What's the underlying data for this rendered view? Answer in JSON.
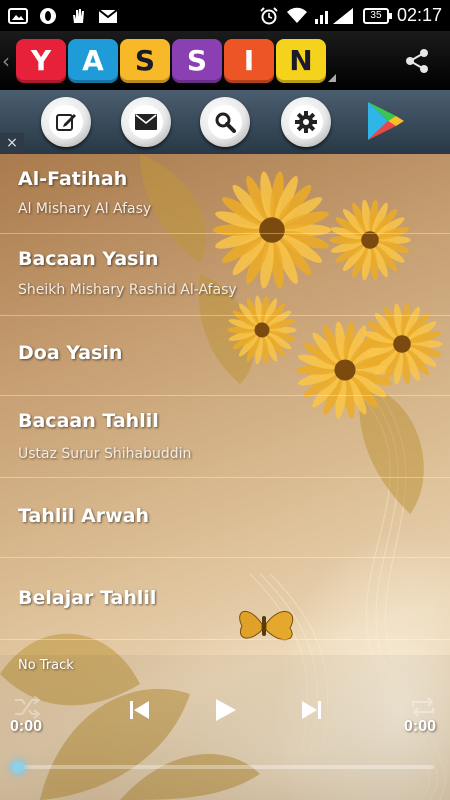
{
  "status_bar": {
    "time": "02:17",
    "battery_level": "35",
    "icons": [
      "gallery-icon",
      "opera-icon",
      "hand-icon",
      "gmail-icon",
      "alarm-icon",
      "wifi-icon",
      "signal-icon",
      "battery-icon"
    ]
  },
  "app": {
    "logo_letters": [
      {
        "letter": "Y",
        "color": "#e8213a"
      },
      {
        "letter": "A",
        "color": "#1f9bd8"
      },
      {
        "letter": "S",
        "color": "#f7b928"
      },
      {
        "letter": "S",
        "color": "#8a3fb3"
      },
      {
        "letter": "I",
        "color": "#ee5525"
      },
      {
        "letter": "N",
        "color": "#f5d31c"
      }
    ]
  },
  "toolbar": {
    "buttons": [
      "edit-icon",
      "mail-icon",
      "search-icon",
      "settings-icon",
      "play-store-icon"
    ],
    "close_label": "×"
  },
  "tracks": [
    {
      "title": "Al-Fatihah",
      "subtitle": "Al Mishary Al Afasy"
    },
    {
      "title": "Bacaan Yasin",
      "subtitle": "Sheikh Mishary Rashid Al-Afasy"
    },
    {
      "title": "Doa Yasin",
      "subtitle": ""
    },
    {
      "title": "Bacaan Tahlil",
      "subtitle": "Ustaz Surur Shihabuddin"
    },
    {
      "title": "Tahlil Arwah",
      "subtitle": ""
    },
    {
      "title": "Belajar Tahlil",
      "subtitle": ""
    }
  ],
  "player": {
    "now_playing": "No Track",
    "elapsed": "0:00",
    "duration": "0:00",
    "progress": 0
  }
}
